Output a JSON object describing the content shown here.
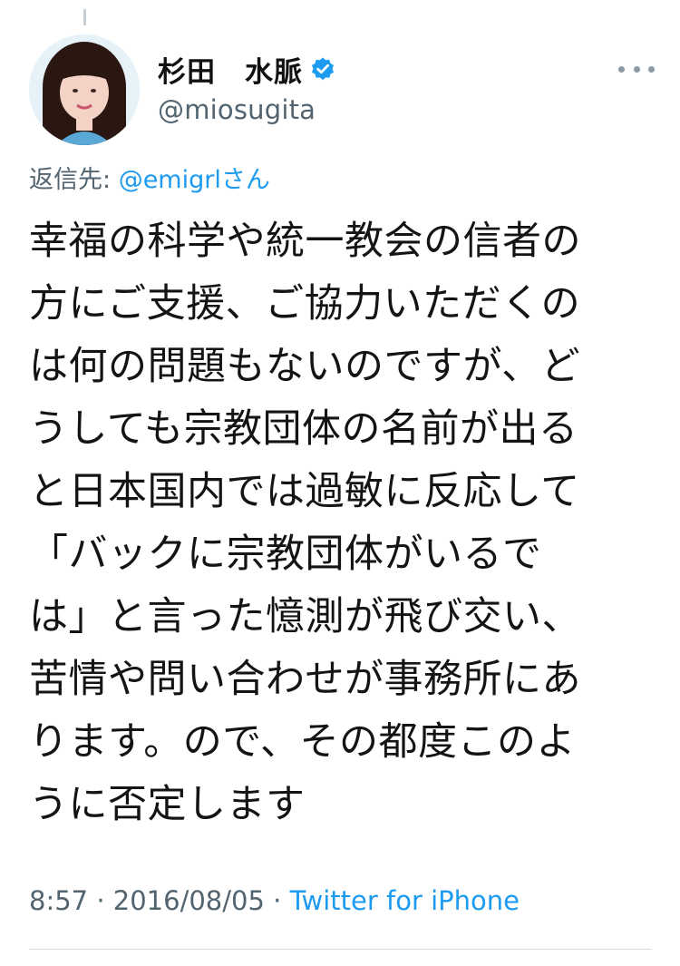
{
  "tweet": {
    "author": {
      "display_name": "杉田　水脈",
      "handle": "@miosugita",
      "verified": true
    },
    "reply_to": {
      "label": "返信先: ",
      "mention": "@emigrl",
      "suffix": "さん"
    },
    "text_lines": [
      "幸福の科学や統一教会の信者の",
      "方にご支援、ご協力いただくの",
      "は何の問題もないのですが、ど",
      "うしても宗教団体の名前が出る",
      "と日本国内では過敏に反応して",
      "「バックに宗教団体がいるで",
      "は」と言った憶測が飛び交い、",
      "苦情や問い合わせが事務所にあ",
      "ります。ので、その都度このよ",
      "うに否定します"
    ],
    "meta": {
      "time": "8:57",
      "separator1": " · ",
      "date": "2016/08/05",
      "separator2": " · ",
      "source": "Twitter for iPhone"
    }
  },
  "icons": {
    "verified": "verified-badge-icon",
    "more": "more-options-icon"
  },
  "colors": {
    "link": "#1d9bf0",
    "secondary_text": "#536471",
    "verified_badge": "#1d9bf0"
  }
}
